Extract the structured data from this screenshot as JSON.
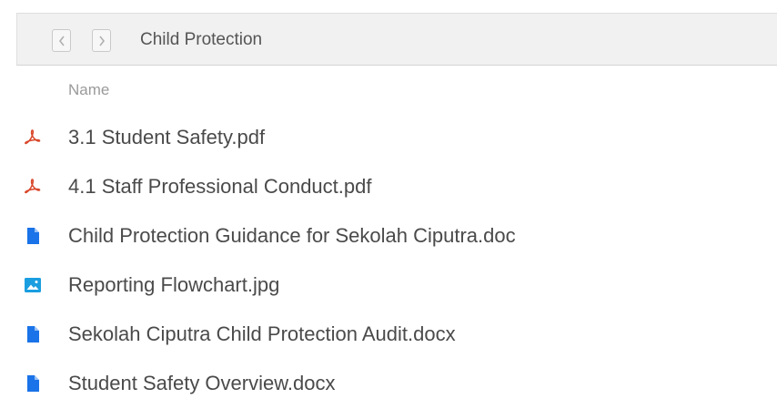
{
  "header": {
    "folder_title": "Child Protection",
    "back_icon": "chevron-left-icon",
    "forward_icon": "chevron-right-icon"
  },
  "list": {
    "column_name": "Name",
    "files": [
      {
        "name": "3.1 Student Safety.pdf",
        "type": "pdf",
        "icon": "pdf-icon",
        "color": "#d9482b"
      },
      {
        "name": "4.1 Staff Professional Conduct.pdf",
        "type": "pdf",
        "icon": "pdf-icon",
        "color": "#d9482b"
      },
      {
        "name": "Child Protection Guidance for Sekolah Ciputra.doc",
        "type": "doc",
        "icon": "document-icon",
        "color": "#1a73e8"
      },
      {
        "name": "Reporting Flowchart.jpg",
        "type": "image",
        "icon": "image-icon",
        "color": "#1a9ee0"
      },
      {
        "name": "Sekolah Ciputra Child Protection Audit.docx",
        "type": "doc",
        "icon": "document-icon",
        "color": "#1a73e8"
      },
      {
        "name": "Student Safety Overview.docx",
        "type": "doc",
        "icon": "document-icon",
        "color": "#1a73e8"
      }
    ]
  }
}
